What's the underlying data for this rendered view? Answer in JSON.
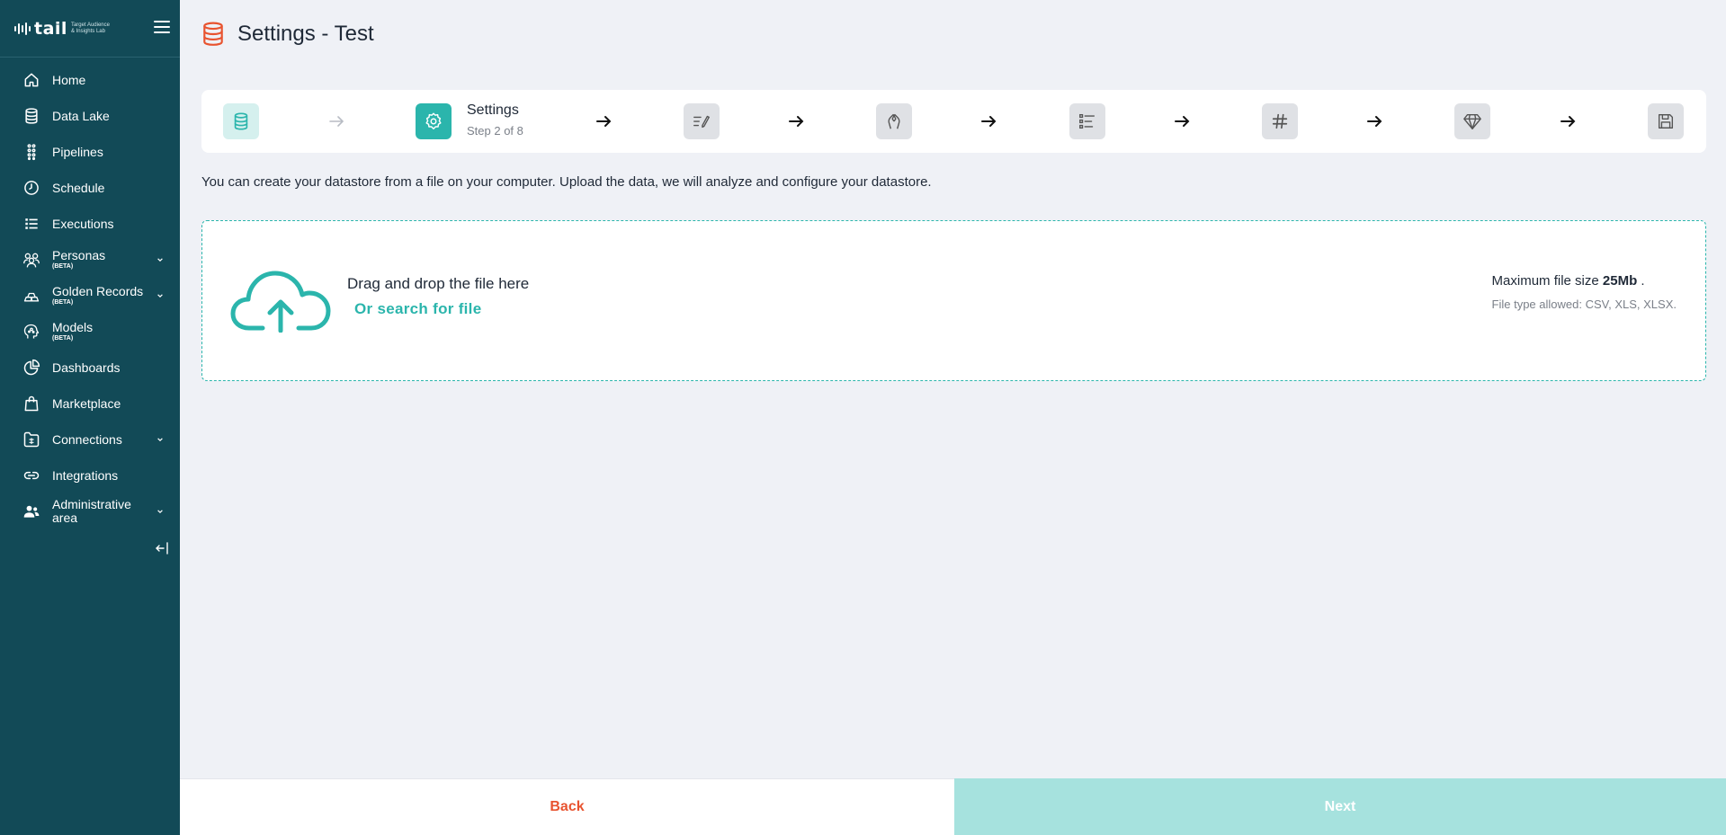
{
  "app": {
    "logo_word": "tail",
    "logo_tagline": "Target Audience & Insights Lab"
  },
  "sidebar": {
    "items": [
      {
        "label": "Home",
        "icon": "home-icon"
      },
      {
        "label": "Data Lake",
        "icon": "database-icon"
      },
      {
        "label": "Pipelines",
        "icon": "pipeline-icon"
      },
      {
        "label": "Schedule",
        "icon": "clock-icon"
      },
      {
        "label": "Executions",
        "icon": "list-icon"
      },
      {
        "label": "Personas",
        "badge": "(BETA)",
        "icon": "personas-icon",
        "expandable": true
      },
      {
        "label": "Golden Records",
        "badge": "(BETA)",
        "icon": "gold-bars-icon",
        "expandable": true
      },
      {
        "label": "Models",
        "badge": "(BETA)",
        "icon": "brain-head-icon"
      },
      {
        "label": "Dashboards",
        "icon": "pie-chart-icon"
      },
      {
        "label": "Marketplace",
        "icon": "shopping-bag-icon"
      },
      {
        "label": "Connections",
        "icon": "connections-icon",
        "expandable": true
      },
      {
        "label": "Integrations",
        "icon": "link-icon"
      },
      {
        "label": "Administrative area",
        "icon": "users-admin-icon",
        "expandable": true
      }
    ]
  },
  "header": {
    "title": "Settings - Test"
  },
  "stepper": {
    "current_title": "Settings",
    "current_subtitle": "Step 2 of 8",
    "steps": [
      {
        "icon": "database-icon",
        "state": "done"
      },
      {
        "icon": "gear-icon",
        "state": "active"
      },
      {
        "icon": "edit-list-icon",
        "state": "pending"
      },
      {
        "icon": "hands-icon",
        "state": "pending"
      },
      {
        "icon": "checklist-icon",
        "state": "pending"
      },
      {
        "icon": "hash-icon",
        "state": "pending"
      },
      {
        "icon": "diamond-icon",
        "state": "pending"
      },
      {
        "icon": "save-icon",
        "state": "pending"
      }
    ]
  },
  "intro_text": "You can create your datastore from a file on your computer. Upload the data, we will analyze and configure your datastore.",
  "dropzone": {
    "drag_text": "Drag and drop the file here",
    "search_text": "Or search for file",
    "max_size_label": "Maximum file size",
    "max_size_value": "25Mb",
    "max_size_suffix": ".",
    "types_text": "File type allowed: CSV, XLS, XLSX."
  },
  "footer": {
    "back_label": "Back",
    "next_label": "Next"
  },
  "colors": {
    "sidebar_bg": "#124a57",
    "accent": "#2bb5ac",
    "back_text": "#e8532f",
    "next_bg_disabled": "#a6e2de",
    "page_bg": "#eff1f6"
  }
}
